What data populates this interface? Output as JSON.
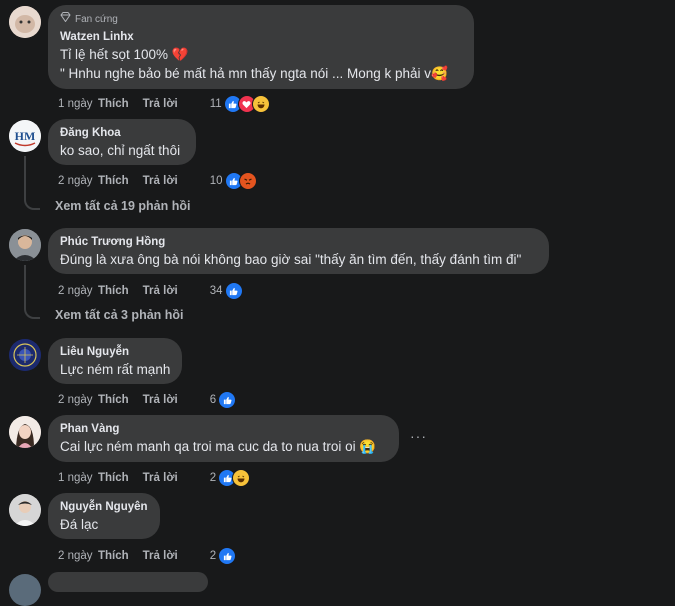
{
  "comments": [
    {
      "author": "Watzen Linhx",
      "badge": "Fan cứng",
      "lines": [
        "Tỉ lệ hết sọt 100% 💔",
        "\" Hnhu nghe bảo bé mất hả mn thấy ngta nói ... Mong k phải v🥰"
      ],
      "time": "1 ngày",
      "like_label": "Thích",
      "reply_label": "Trả lời",
      "reactions": "11"
    },
    {
      "author": "Đăng Khoa",
      "lines": [
        "ko sao, chỉ ngất thôi"
      ],
      "time": "2 ngày",
      "like_label": "Thích",
      "reply_label": "Trả lời",
      "reactions": "10",
      "view_replies": "Xem tất cả 19 phản hồi"
    },
    {
      "author": "Phúc Trương Hồng",
      "lines": [
        "Đúng là xưa ông bà nói không bao giờ sai \"thấy ăn tìm đến, thấy đánh tìm đi\""
      ],
      "time": "2 ngày",
      "like_label": "Thích",
      "reply_label": "Trả lời",
      "reactions": "34",
      "view_replies": "Xem tất cả 3 phản hồi"
    },
    {
      "author": "Liêu Nguyễn",
      "lines": [
        "Lực ném rất mạnh"
      ],
      "time": "2 ngày",
      "like_label": "Thích",
      "reply_label": "Trả lời",
      "reactions": "6"
    },
    {
      "author": "Phan Vàng",
      "lines": [
        "Cai lực ném manh qa troi ma cuc da to nua troi oi 😭"
      ],
      "time": "1 ngày",
      "like_label": "Thích",
      "reply_label": "Trả lời",
      "reactions": "2",
      "more": "···"
    },
    {
      "author": "Nguyễn Nguyên",
      "lines": [
        "Đá lạc"
      ],
      "time": "2 ngày",
      "like_label": "Thích",
      "reply_label": "Trả lời",
      "reactions": "2"
    }
  ],
  "icons": {
    "like": "like-reaction-icon",
    "love": "love-reaction-icon",
    "haha": "haha-reaction-icon",
    "angry": "angry-reaction-icon",
    "badge": "diamond-icon"
  },
  "colors": {
    "background": "#18191a",
    "bubble": "#3a3b3c",
    "like": "#2078f4",
    "love": "#f0334f",
    "haha": "#f7c23a",
    "angry": "#e4541f"
  }
}
